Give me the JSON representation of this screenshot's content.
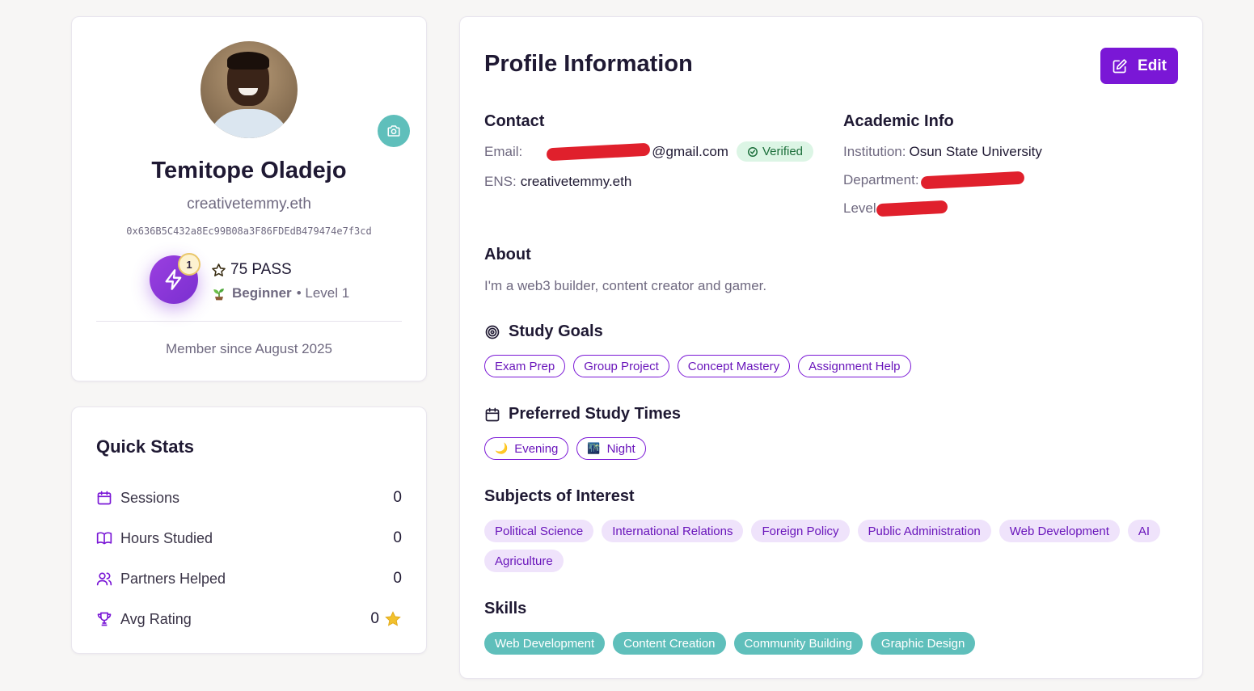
{
  "profile": {
    "name": "Temitope Oladejo",
    "ens": "creativetemmy.eth",
    "address": "0x636B5C432a8Ec99B08a3F86FDEdB479474e7f3cd",
    "level_count": "1",
    "pass_text": "75 PASS",
    "rank_name": "Beginner",
    "rank_level": "• Level 1",
    "member_since": "Member since August 2025"
  },
  "stats": {
    "title": "Quick Stats",
    "items": [
      {
        "label": "Sessions",
        "value": "0",
        "icon": "calendar-icon"
      },
      {
        "label": "Hours Studied",
        "value": "0",
        "icon": "book-icon"
      },
      {
        "label": "Partners Helped",
        "value": "0",
        "icon": "users-icon"
      },
      {
        "label": "Avg Rating",
        "value": "0",
        "icon": "trophy-icon"
      }
    ]
  },
  "info": {
    "title": "Profile Information",
    "edit_label": "Edit",
    "contact": {
      "heading": "Contact",
      "email_label": "Email:",
      "email_visible": "@gmail.com",
      "verified_label": "Verified",
      "ens_label": "ENS:",
      "ens_value": "creativetemmy.eth"
    },
    "academic": {
      "heading": "Academic Info",
      "institution_label": "Institution:",
      "institution_value": "Osun State University",
      "department_label": "Department:",
      "level_label": "Level"
    },
    "about": {
      "heading": "About",
      "text": "I'm a web3 builder, content creator and gamer."
    },
    "study_goals": {
      "heading": "Study Goals",
      "items": [
        "Exam Prep",
        "Group Project",
        "Concept Mastery",
        "Assignment Help"
      ]
    },
    "study_times": {
      "heading": "Preferred Study Times",
      "items": [
        {
          "label": "Evening",
          "emoji": "🌙"
        },
        {
          "label": "Night",
          "emoji": "🌃"
        }
      ]
    },
    "subjects": {
      "heading": "Subjects of Interest",
      "items": [
        "Political Science",
        "International Relations",
        "Foreign Policy",
        "Public Administration",
        "Web Development",
        "AI",
        "Agriculture"
      ]
    },
    "skills": {
      "heading": "Skills",
      "items": [
        "Web Development",
        "Content Creation",
        "Community Building",
        "Graphic Design"
      ]
    }
  },
  "colors": {
    "accent": "#7a17d6",
    "teal": "#5fbfbb",
    "verified_bg": "#dcf5e5",
    "chip_soft_bg": "#efe3fb"
  }
}
